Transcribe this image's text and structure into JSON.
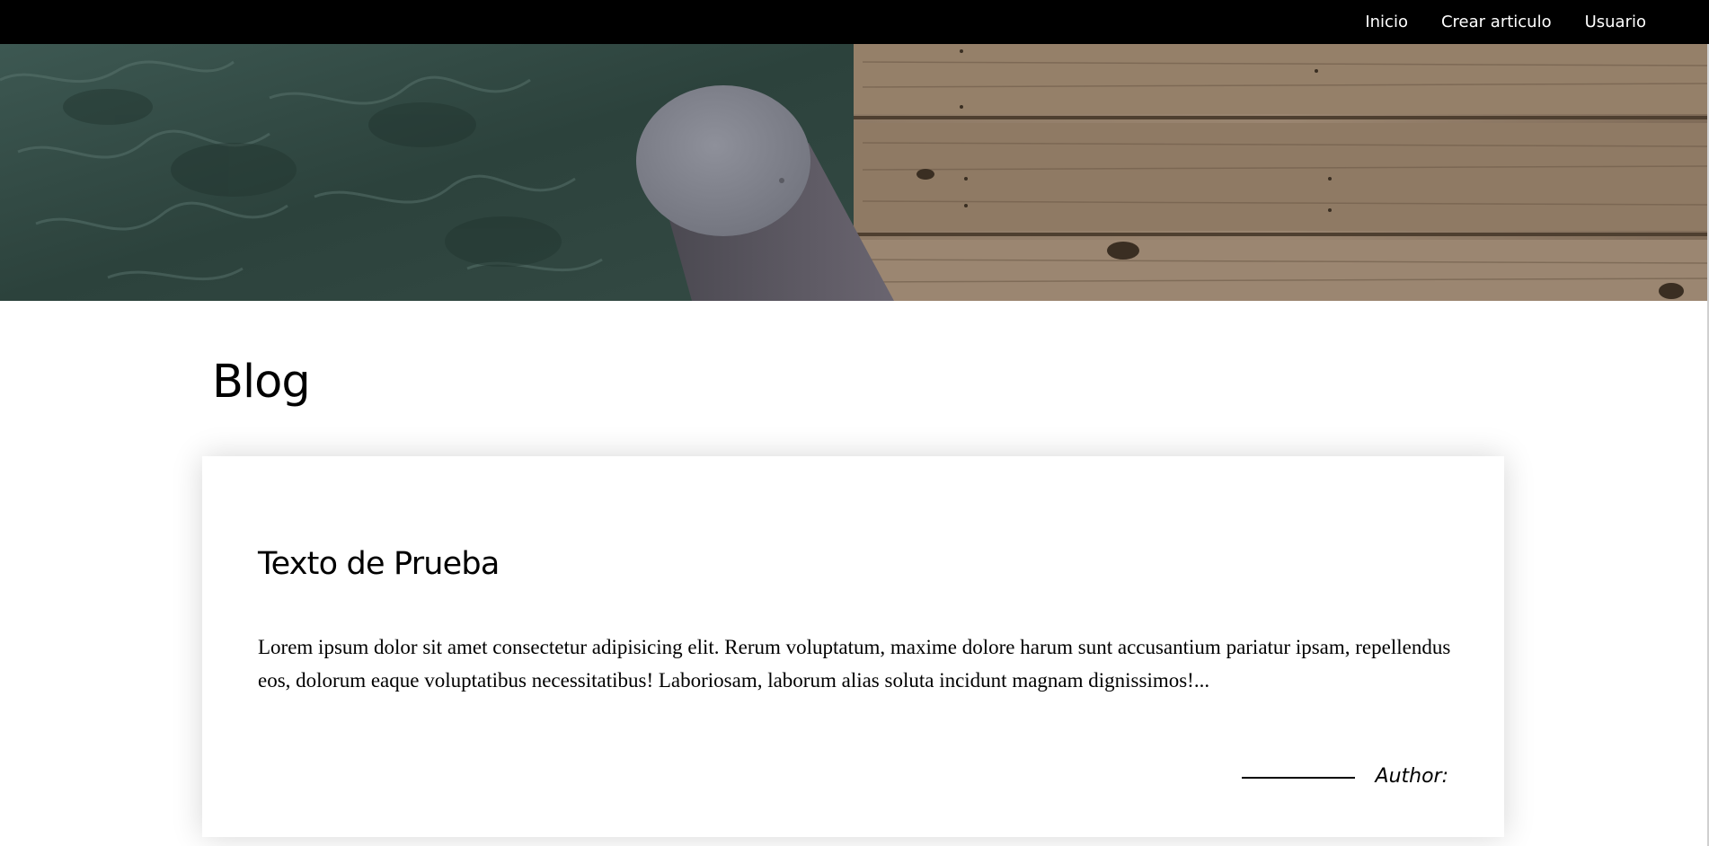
{
  "nav": {
    "items": [
      {
        "label": "Inicio"
      },
      {
        "label": "Crear articulo"
      },
      {
        "label": "Usuario"
      }
    ]
  },
  "hero": {
    "image": "dock-water-post-photo"
  },
  "main": {
    "title": "Blog"
  },
  "posts": [
    {
      "title": "Texto de Prueba",
      "excerpt": "Lorem ipsum dolor sit amet consectetur adipisicing elit. Rerum voluptatum, maxime dolore harum sunt accusantium pariatur ipsam, repellendus eos, dolorum eaque voluptatibus necessitatibus! Laboriosam, laborum alias soluta incidunt magnam dignissimos!...",
      "author_label": "Author:"
    }
  ],
  "colors": {
    "nav_background": "#000000",
    "nav_text": "#ffffff",
    "water": "#2f4640",
    "wood": "#8a7560",
    "post": "#85868f"
  }
}
